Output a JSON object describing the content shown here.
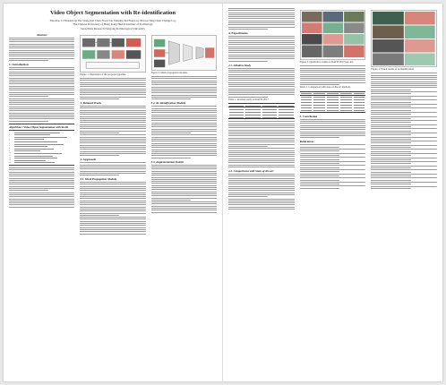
{
  "page1": {
    "title": "Video Object Segmentation with Re-identification",
    "authors": "Xiaoxiao Li  Yuankai Qi  Zhe Wang  Kai Chen  Ziwei Liu  Jianping Shi  Ping Luo  Xiaoou Tang  Chen Change Loy",
    "affiliations": [
      "The Chinese University of Hong Kong   Harbin Institute of Technology",
      "SenseTime Research   Nanyang Technological University"
    ],
    "abstract_heading": "Abstract",
    "sections": {
      "intro": "1. Introduction",
      "related": "2. Related Work",
      "approach": "3. Approach",
      "mask_prop": "3.1. Mask Propagation Module",
      "reid": "3.2. Re-identification Module",
      "implementation": "3.3. Implementation Details"
    },
    "algorithm_title": "Algorithm 1 Video Object Segmentation with Re-ID",
    "figure1_caption": "Figure 1. Illustration of the proposed pipeline.",
    "figure2_caption": "Figure 2. Mask propagation module."
  },
  "page2": {
    "sections": {
      "experiments": "4. Experiments",
      "ablation": "4.1. Ablation Study",
      "comparison": "4.2. Comparisons with State-of-the-art",
      "conclusion": "5. Conclusion",
      "references": "References"
    },
    "figure3_caption": "Figure 3. Qualitative results on DAVIS 2017 test-dev.",
    "table1_caption": "Table 1. Ablation study on DAVIS 2017.",
    "table2_caption": "Table 2. Comparison with state-of-the-art methods.",
    "figure4_caption": "Figure 4. Visual results of re-identification."
  },
  "colors": {
    "paper": "#ffffff",
    "background": "#e9e9e9",
    "figure_red": "#c0392b",
    "figure_green": "#2e8b57",
    "figure_dark": "#3a3a3a"
  }
}
